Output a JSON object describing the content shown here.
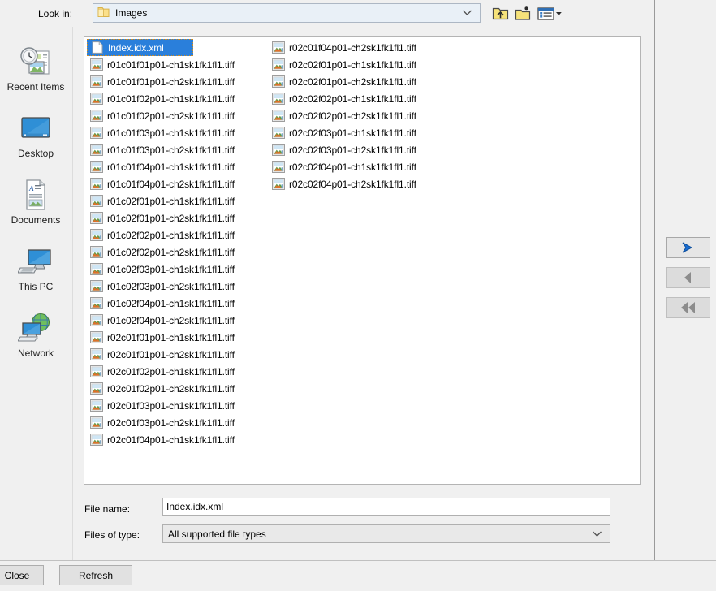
{
  "dialog": {
    "lookin": {
      "label": "Look in:",
      "value": "Images",
      "icon": "folder-icon",
      "arrow_icon": "chevron-down-icon"
    },
    "toolbar": [
      {
        "name": "up-one-level-button",
        "icon": "folder-up-icon"
      },
      {
        "name": "create-new-folder-button",
        "icon": "new-folder-icon"
      },
      {
        "name": "views-button",
        "icon": "views-list-icon"
      }
    ]
  },
  "places": {
    "items": [
      {
        "label": "Recent Items",
        "icon": "recent-items-icon"
      },
      {
        "label": "Desktop",
        "icon": "desktop-icon"
      },
      {
        "label": "Documents",
        "icon": "documents-icon"
      },
      {
        "label": "This PC",
        "icon": "this-pc-icon"
      },
      {
        "label": "Network",
        "icon": "network-icon"
      }
    ]
  },
  "filelist": {
    "columns": [
      {
        "items": [
          {
            "name": "Index.idx.xml",
            "icon": "xml-file-icon",
            "selected": true
          },
          {
            "name": "r01c01f01p01-ch1sk1fk1fl1.tiff",
            "icon": "image-file-icon",
            "selected": false
          },
          {
            "name": "r01c01f01p01-ch2sk1fk1fl1.tiff",
            "icon": "image-file-icon",
            "selected": false
          },
          {
            "name": "r01c01f02p01-ch1sk1fk1fl1.tiff",
            "icon": "image-file-icon",
            "selected": false
          },
          {
            "name": "r01c01f02p01-ch2sk1fk1fl1.tiff",
            "icon": "image-file-icon",
            "selected": false
          },
          {
            "name": "r01c01f03p01-ch1sk1fk1fl1.tiff",
            "icon": "image-file-icon",
            "selected": false
          },
          {
            "name": "r01c01f03p01-ch2sk1fk1fl1.tiff",
            "icon": "image-file-icon",
            "selected": false
          },
          {
            "name": "r01c01f04p01-ch1sk1fk1fl1.tiff",
            "icon": "image-file-icon",
            "selected": false
          },
          {
            "name": "r01c01f04p01-ch2sk1fk1fl1.tiff",
            "icon": "image-file-icon",
            "selected": false
          },
          {
            "name": "r01c02f01p01-ch1sk1fk1fl1.tiff",
            "icon": "image-file-icon",
            "selected": false
          },
          {
            "name": "r01c02f01p01-ch2sk1fk1fl1.tiff",
            "icon": "image-file-icon",
            "selected": false
          },
          {
            "name": "r01c02f02p01-ch1sk1fk1fl1.tiff",
            "icon": "image-file-icon",
            "selected": false
          },
          {
            "name": "r01c02f02p01-ch2sk1fk1fl1.tiff",
            "icon": "image-file-icon",
            "selected": false
          },
          {
            "name": "r01c02f03p01-ch1sk1fk1fl1.tiff",
            "icon": "image-file-icon",
            "selected": false
          },
          {
            "name": "r01c02f03p01-ch2sk1fk1fl1.tiff",
            "icon": "image-file-icon",
            "selected": false
          },
          {
            "name": "r01c02f04p01-ch1sk1fk1fl1.tiff",
            "icon": "image-file-icon",
            "selected": false
          },
          {
            "name": "r01c02f04p01-ch2sk1fk1fl1.tiff",
            "icon": "image-file-icon",
            "selected": false
          },
          {
            "name": "r02c01f01p01-ch1sk1fk1fl1.tiff",
            "icon": "image-file-icon",
            "selected": false
          },
          {
            "name": "r02c01f01p01-ch2sk1fk1fl1.tiff",
            "icon": "image-file-icon",
            "selected": false
          },
          {
            "name": "r02c01f02p01-ch1sk1fk1fl1.tiff",
            "icon": "image-file-icon",
            "selected": false
          },
          {
            "name": "r02c01f02p01-ch2sk1fk1fl1.tiff",
            "icon": "image-file-icon",
            "selected": false
          },
          {
            "name": "r02c01f03p01-ch1sk1fk1fl1.tiff",
            "icon": "image-file-icon",
            "selected": false
          },
          {
            "name": "r02c01f03p01-ch2sk1fk1fl1.tiff",
            "icon": "image-file-icon",
            "selected": false
          },
          {
            "name": "r02c01f04p01-ch1sk1fk1fl1.tiff",
            "icon": "image-file-icon",
            "selected": false
          }
        ]
      },
      {
        "items": [
          {
            "name": "r02c01f04p01-ch2sk1fk1fl1.tiff",
            "icon": "image-file-icon",
            "selected": false
          },
          {
            "name": "r02c02f01p01-ch1sk1fk1fl1.tiff",
            "icon": "image-file-icon",
            "selected": false
          },
          {
            "name": "r02c02f01p01-ch2sk1fk1fl1.tiff",
            "icon": "image-file-icon",
            "selected": false
          },
          {
            "name": "r02c02f02p01-ch1sk1fk1fl1.tiff",
            "icon": "image-file-icon",
            "selected": false
          },
          {
            "name": "r02c02f02p01-ch2sk1fk1fl1.tiff",
            "icon": "image-file-icon",
            "selected": false
          },
          {
            "name": "r02c02f03p01-ch1sk1fk1fl1.tiff",
            "icon": "image-file-icon",
            "selected": false
          },
          {
            "name": "r02c02f03p01-ch2sk1fk1fl1.tiff",
            "icon": "image-file-icon",
            "selected": false
          },
          {
            "name": "r02c02f04p01-ch1sk1fk1fl1.tiff",
            "icon": "image-file-icon",
            "selected": false
          },
          {
            "name": "r02c02f04p01-ch2sk1fk1fl1.tiff",
            "icon": "image-file-icon",
            "selected": false
          }
        ]
      }
    ]
  },
  "form": {
    "filename_label": "File name:",
    "filename_value": "Index.idx.xml",
    "filetype_label": "Files of type:",
    "filetype_value": "All supported file types",
    "filetype_arrow_icon": "chevron-down-icon"
  },
  "transfer": {
    "buttons": [
      {
        "name": "add-button",
        "glyph": "➤",
        "enabled": true
      },
      {
        "name": "remove-button",
        "glyph": "◀",
        "enabled": false
      },
      {
        "name": "remove-all-button",
        "glyph": "«",
        "enabled": false
      }
    ]
  },
  "bottom": {
    "close_label": "Close",
    "refresh_label": "Refresh"
  },
  "colors": {
    "selection": "#2a7fdb",
    "focus_border": "#c98b2a",
    "enabled_arrow": "#1a6fd4",
    "disabled_arrow": "#8c8c8c",
    "window_bg": "#f0f0f0",
    "list_bg": "#ffffff",
    "combo_bg": "#e9f0f7"
  }
}
